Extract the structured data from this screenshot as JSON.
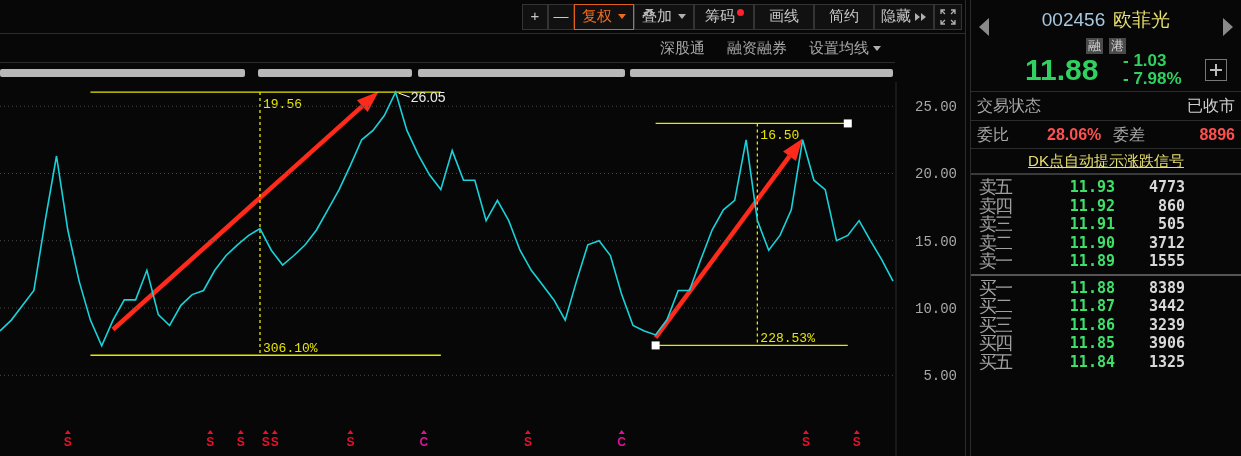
{
  "toolbar": {
    "buttons": [
      {
        "label": "+",
        "kind": "plain",
        "selected": false
      },
      {
        "label": "—",
        "kind": "plain",
        "selected": false
      },
      {
        "label": "复权",
        "kind": "dropdown",
        "selected": true
      },
      {
        "label": "叠加",
        "kind": "dropdown",
        "selected": false
      },
      {
        "label": "筹码",
        "kind": "dot",
        "selected": false
      },
      {
        "label": "画线",
        "kind": "plain",
        "selected": false
      },
      {
        "label": "简约",
        "kind": "plain",
        "selected": false
      },
      {
        "label": "隐藏",
        "kind": "expand",
        "selected": false
      },
      {
        "kind": "fullscreen",
        "selected": false
      }
    ]
  },
  "subbar": [
    {
      "label": "深股通",
      "kind": "plain"
    },
    {
      "label": "融资融券",
      "kind": "plain"
    },
    {
      "label": "设置均线",
      "kind": "dropdown"
    }
  ],
  "chart": {
    "chart_data": {
      "type": "line",
      "ylim": [
        -1,
        26.8
      ],
      "grid": true,
      "yticks": [
        {
          "value": 25,
          "label": "25.00"
        },
        {
          "value": 20,
          "label": "20.00"
        },
        {
          "value": 15,
          "label": "15.00"
        },
        {
          "value": 10,
          "label": "10.00"
        },
        {
          "value": 5,
          "label": "5.00"
        }
      ],
      "series": [
        {
          "color": "#19d3da",
          "values": [
            8.3,
            9.1,
            10.2,
            11.3,
            16.5,
            21.3,
            15.8,
            12,
            9.1,
            7.2,
            9.1,
            10.6,
            10.6,
            12.8,
            9.5,
            8.7,
            10.2,
            11,
            11.3,
            12.8,
            13.9,
            14.7,
            15.4,
            15.9,
            14.3,
            13.2,
            13.9,
            14.7,
            15.8,
            17.3,
            18.8,
            20.6,
            22.5,
            23.2,
            24.3,
            26.05,
            23.2,
            21.4,
            19.9,
            18.8,
            21.7,
            19.5,
            19.5,
            16.5,
            18,
            16.5,
            14.3,
            12.8,
            11.7,
            10.6,
            9.1,
            12,
            14.7,
            15,
            13.9,
            11,
            8.7,
            8.3,
            8,
            9.1,
            11.3,
            11.3,
            13.6,
            15.8,
            17.3,
            18,
            22.5,
            16.5,
            14.3,
            15.4,
            17.3,
            22.5,
            19.5,
            18.8,
            15,
            15.4,
            16.5,
            15,
            13.6,
            12
          ]
        }
      ]
    },
    "overlays": [
      {
        "kind": "range",
        "change": "19.56",
        "percent": "306.10%",
        "handles": false
      },
      {
        "kind": "range",
        "change": "16.50",
        "percent": "228.53%",
        "handles": true
      },
      {
        "kind": "peak",
        "text": "26.05"
      },
      {
        "kind": "signal",
        "text": "S",
        "color": "#e8102a"
      },
      {
        "kind": "signal",
        "text": "S",
        "color": "#e8102a"
      },
      {
        "kind": "signal",
        "text": "S",
        "color": "#e8102a"
      },
      {
        "kind": "signal",
        "text": "S",
        "color": "#e8102a"
      },
      {
        "kind": "signal",
        "text": "S",
        "color": "#e8102a"
      },
      {
        "kind": "signal",
        "text": "S",
        "color": "#e8102a"
      },
      {
        "kind": "signal",
        "text": "C",
        "color": "#e0109a"
      },
      {
        "kind": "signal",
        "text": "S",
        "color": "#e8102a"
      },
      {
        "kind": "signal",
        "text": "C",
        "color": "#e0109a"
      },
      {
        "kind": "signal",
        "text": "S",
        "color": "#e8102a"
      },
      {
        "kind": "signal",
        "text": "S",
        "color": "#e8102a"
      }
    ]
  },
  "quote": {
    "code": "002456",
    "name": "欧菲光",
    "badges": [
      "融",
      "港"
    ],
    "price": "11.88",
    "change": "- 1.03",
    "change_pct": "- 7.98%",
    "falling": true
  },
  "status": {
    "label": "交易状态",
    "value": "已收市"
  },
  "ratio": {
    "label": "委比",
    "value": "28.06%",
    "diff_label": "委差",
    "diff_value": "8896"
  },
  "signal_link": "DK点自动提示涨跌信号",
  "asks": [
    {
      "label": "卖五",
      "price": "11.93",
      "volume": "4773"
    },
    {
      "label": "卖四",
      "price": "11.92",
      "volume": "860"
    },
    {
      "label": "卖三",
      "price": "11.91",
      "volume": "505"
    },
    {
      "label": "卖二",
      "price": "11.90",
      "volume": "3712"
    },
    {
      "label": "卖一",
      "price": "11.89",
      "volume": "1555"
    }
  ],
  "bids": [
    {
      "label": "买一",
      "price": "11.88",
      "volume": "8389"
    },
    {
      "label": "买二",
      "price": "11.87",
      "volume": "3442"
    },
    {
      "label": "买三",
      "price": "11.86",
      "volume": "3239"
    },
    {
      "label": "买四",
      "price": "11.85",
      "volume": "3906"
    },
    {
      "label": "买五",
      "price": "11.84",
      "volume": "1325"
    }
  ]
}
